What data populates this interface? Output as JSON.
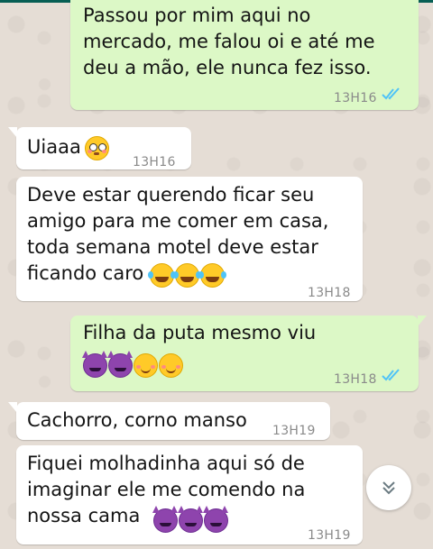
{
  "messages": [
    {
      "direction": "out",
      "text": "Passou por mim aqui no\nmercado, me falou oi e até me\ndeu a mão,  ele nunca fez isso.",
      "time": "13H16",
      "read": true
    },
    {
      "direction": "in",
      "text": "Uiaaa",
      "emojis": [
        "flushed-face"
      ],
      "time": "13H16"
    },
    {
      "direction": "in",
      "text": "Deve estar querendo ficar seu\namigo para me comer em casa,\ntoda semana motel deve estar\nficando caro",
      "emojis": [
        "tears-of-joy-face",
        "tears-of-joy-face",
        "tears-of-joy-face"
      ],
      "time": "13H18"
    },
    {
      "direction": "out",
      "text": "Filha da puta mesmo viu",
      "emojis": [
        "smiling-imp",
        "smiling-imp",
        "smiling-face-blush",
        "smiling-face-blush"
      ],
      "time": "13H18",
      "read": true
    },
    {
      "direction": "in",
      "text": "Cachorro, corno manso",
      "time": "13H19"
    },
    {
      "direction": "in",
      "text": "Fiquei molhadinha aqui só de\nimaginar ele me comendo na\nnossa cama",
      "emojis": [
        "smiling-imp",
        "smiling-imp",
        "smiling-imp"
      ],
      "time": "13H19"
    }
  ],
  "scroll_button": {
    "icon": "double-chevron-down-icon"
  },
  "colors": {
    "outgoing_bubble": "#dcf8c6",
    "incoming_bubble": "#ffffff",
    "chat_background": "#e5ddd5",
    "read_ticks": "#4fc3f7",
    "timestamp": "#8a8a8a"
  }
}
